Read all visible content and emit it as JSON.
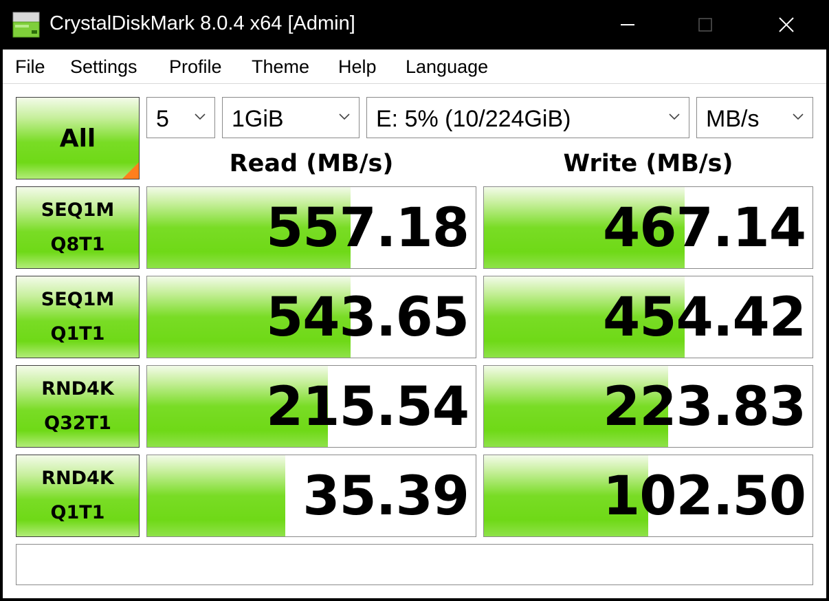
{
  "window": {
    "title": "CrystalDiskMark 8.0.4 x64 [Admin]"
  },
  "menu": [
    "File",
    "Settings",
    "Profile",
    "Theme",
    "Help",
    "Language"
  ],
  "controls": {
    "all_label": "All",
    "count": "5",
    "size": "1GiB",
    "drive": "E: 5% (10/224GiB)",
    "unit": "MB/s"
  },
  "headers": {
    "read": "Read (MB/s)",
    "write": "Write (MB/s)"
  },
  "tests": [
    {
      "line1": "SEQ1M",
      "line2": "Q8T1",
      "read": "557.18",
      "write": "467.14",
      "read_fill": 0.62,
      "write_fill": 0.61
    },
    {
      "line1": "SEQ1M",
      "line2": "Q1T1",
      "read": "543.65",
      "write": "454.42",
      "read_fill": 0.62,
      "write_fill": 0.61
    },
    {
      "line1": "RND4K",
      "line2": "Q32T1",
      "read": "215.54",
      "write": "223.83",
      "read_fill": 0.55,
      "write_fill": 0.56
    },
    {
      "line1": "RND4K",
      "line2": "Q1T1",
      "read": "35.39",
      "write": "102.50",
      "read_fill": 0.42,
      "write_fill": 0.5
    }
  ],
  "comment": "",
  "colors": {
    "bar_green": "#79dc25",
    "corner_orange": "#ff7f1d"
  }
}
